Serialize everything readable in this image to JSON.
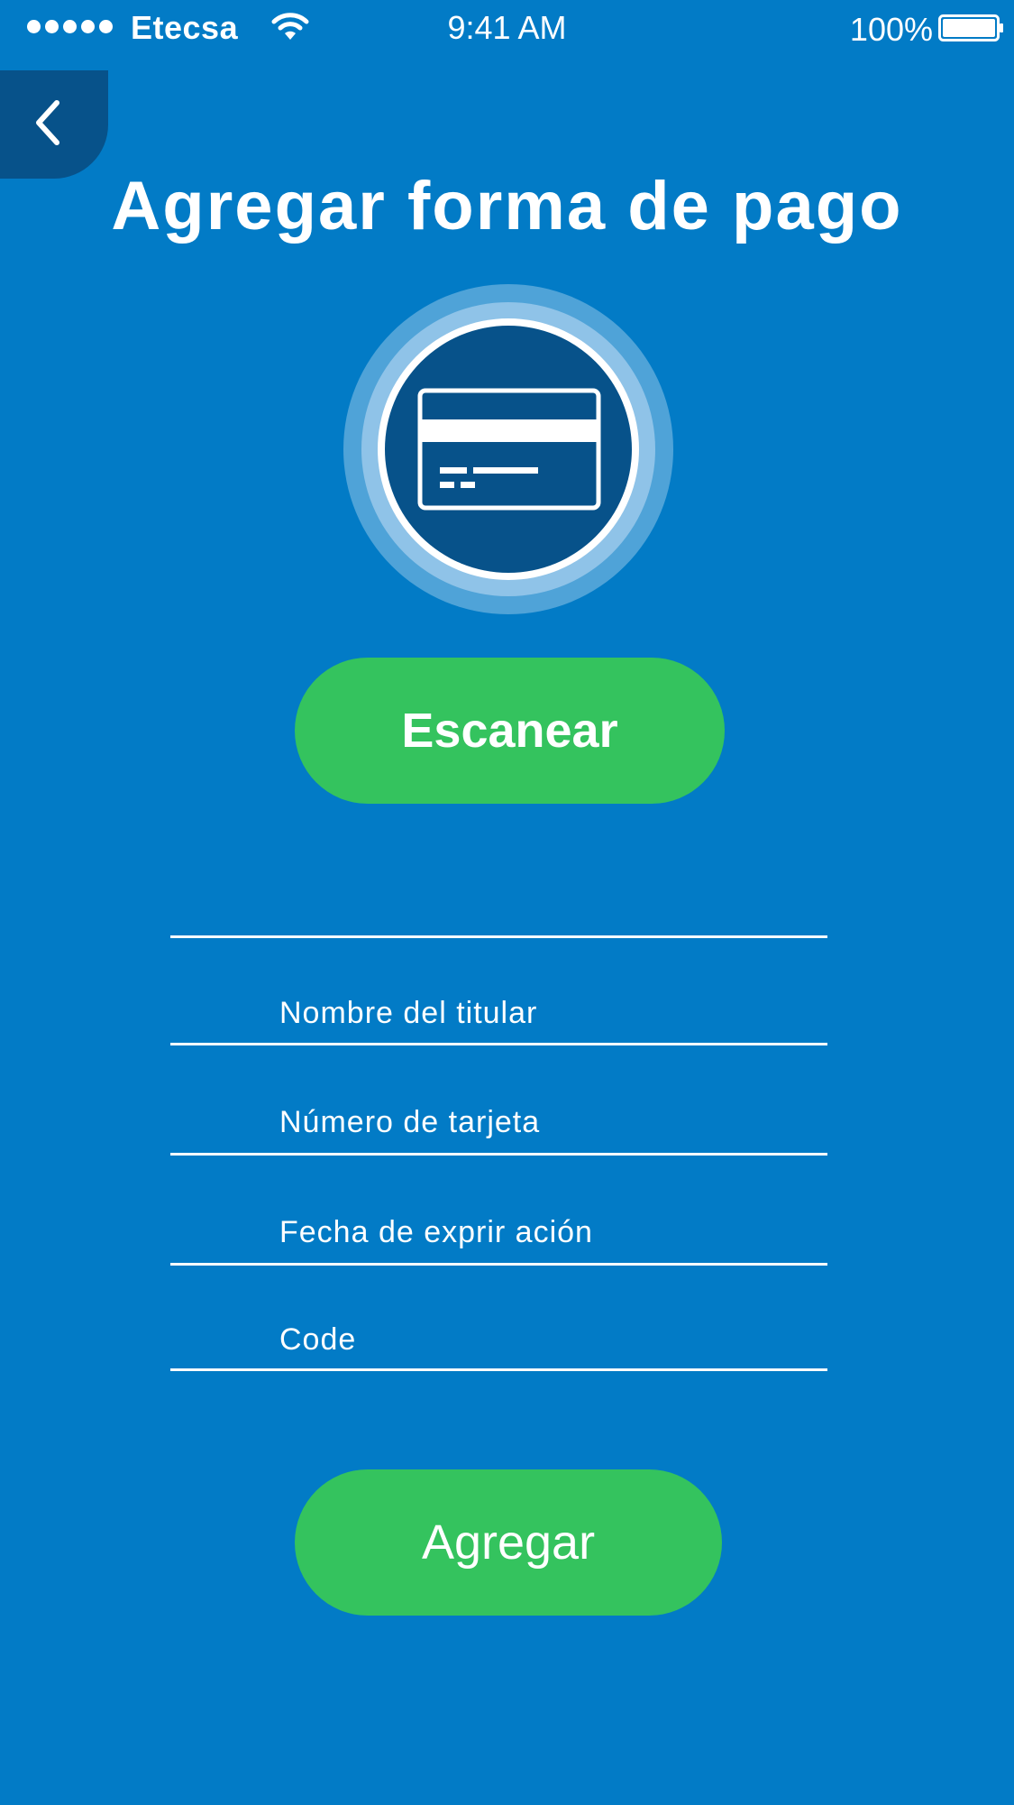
{
  "status_bar": {
    "carrier": "Etecsa",
    "time": "9:41 AM",
    "battery": "100%",
    "signal_icon": "signal-dots-icon",
    "wifi_icon": "wifi-icon",
    "battery_icon": "battery-icon"
  },
  "header": {
    "back_icon": "chevron-left-icon",
    "title": "Agregar forma de pago"
  },
  "emblem": {
    "icon": "credit-card-icon"
  },
  "scan_button": {
    "label": "Escanear"
  },
  "form": {
    "fields": [
      {
        "name": "holder-name",
        "value": "",
        "placeholder": "Nombre del titular"
      },
      {
        "name": "card-number",
        "value": "",
        "placeholder": "Número de tarjeta"
      },
      {
        "name": "expiry-date",
        "value": "",
        "placeholder": "Fecha de exprir ación"
      },
      {
        "name": "code",
        "value": "",
        "placeholder": "Code"
      }
    ]
  },
  "add_button": {
    "label": "Agregar"
  },
  "colors": {
    "background": "#027BC6",
    "dark_blue": "#07528A",
    "green": "#34C35E",
    "ring_outer": "#4FA3D8",
    "ring_inner": "#8FC3E8",
    "white": "#FFFFFF"
  }
}
